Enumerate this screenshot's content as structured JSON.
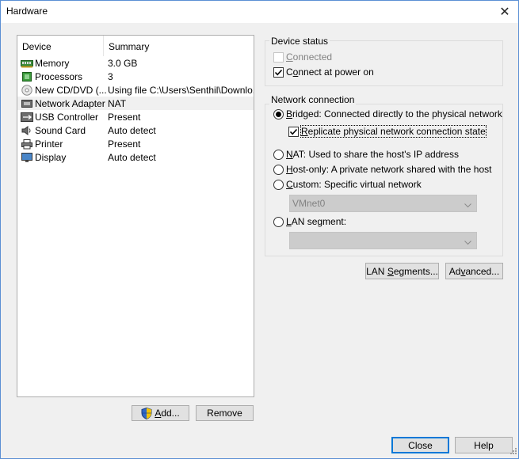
{
  "window": {
    "title": "Hardware",
    "close_glyph": "✕"
  },
  "device_list": {
    "header": {
      "device": "Device",
      "summary": "Summary"
    },
    "items": [
      {
        "device": "Memory",
        "summary": "3.0 GB",
        "icon": "memory-icon"
      },
      {
        "device": "Processors",
        "summary": "3",
        "icon": "processor-icon"
      },
      {
        "device": "New CD/DVD (...",
        "summary": "Using file C:\\Users\\Senthil\\Downlo...",
        "icon": "cd-dvd-icon"
      },
      {
        "device": "Network Adapter",
        "summary": "NAT",
        "icon": "network-adapter-icon",
        "selected": true
      },
      {
        "device": "USB Controller",
        "summary": "Present",
        "icon": "usb-icon"
      },
      {
        "device": "Sound Card",
        "summary": "Auto detect",
        "icon": "sound-card-icon"
      },
      {
        "device": "Printer",
        "summary": "Present",
        "icon": "printer-icon"
      },
      {
        "device": "Display",
        "summary": "Auto detect",
        "icon": "display-icon"
      }
    ],
    "add_label": "Add...",
    "add_key": "A",
    "add_rest": "dd...",
    "remove_label": "Remove"
  },
  "device_status": {
    "title": "Device status",
    "connected": {
      "label": "Connected",
      "key": "C",
      "rest": "onnected",
      "checked": false,
      "disabled": true
    },
    "connect_at_power_on": {
      "label": "Connect at power on",
      "key": "o",
      "pre": "C",
      "rest": "nnect at power on",
      "checked": true
    }
  },
  "network_connection": {
    "title": "Network connection",
    "bridged": {
      "key": "B",
      "rest": "ridged: Connected directly to the physical network",
      "label": "Bridged: Connected directly to the physical network",
      "selected": true
    },
    "replicate": {
      "key": "R",
      "rest": "eplicate physical network connection state",
      "label": "Replicate physical network connection state",
      "checked": true
    },
    "nat": {
      "key": "N",
      "rest": "AT: Used to share the host's IP address",
      "label": "NAT: Used to share the host's IP address",
      "selected": false
    },
    "host_only": {
      "key": "H",
      "rest": "ost-only: A private network shared with the host",
      "label": "Host-only: A private network shared with the host",
      "selected": false
    },
    "custom": {
      "key": "C",
      "rest": "ustom: Specific virtual network",
      "label": "Custom: Specific virtual network",
      "selected": false
    },
    "custom_select_value": "VMnet0",
    "lan_segment": {
      "key": "L",
      "rest": "AN segment:",
      "label": "LAN segment:",
      "selected": false
    },
    "lan_select_value": ""
  },
  "buttons": {
    "lan_segments": {
      "label": "LAN Segments...",
      "pre": "LAN ",
      "key": "S",
      "rest": "egments..."
    },
    "advanced": {
      "label": "Advanced...",
      "pre": "Ad",
      "key": "v",
      "rest": "anced..."
    },
    "close": "Close",
    "help": "Help"
  }
}
